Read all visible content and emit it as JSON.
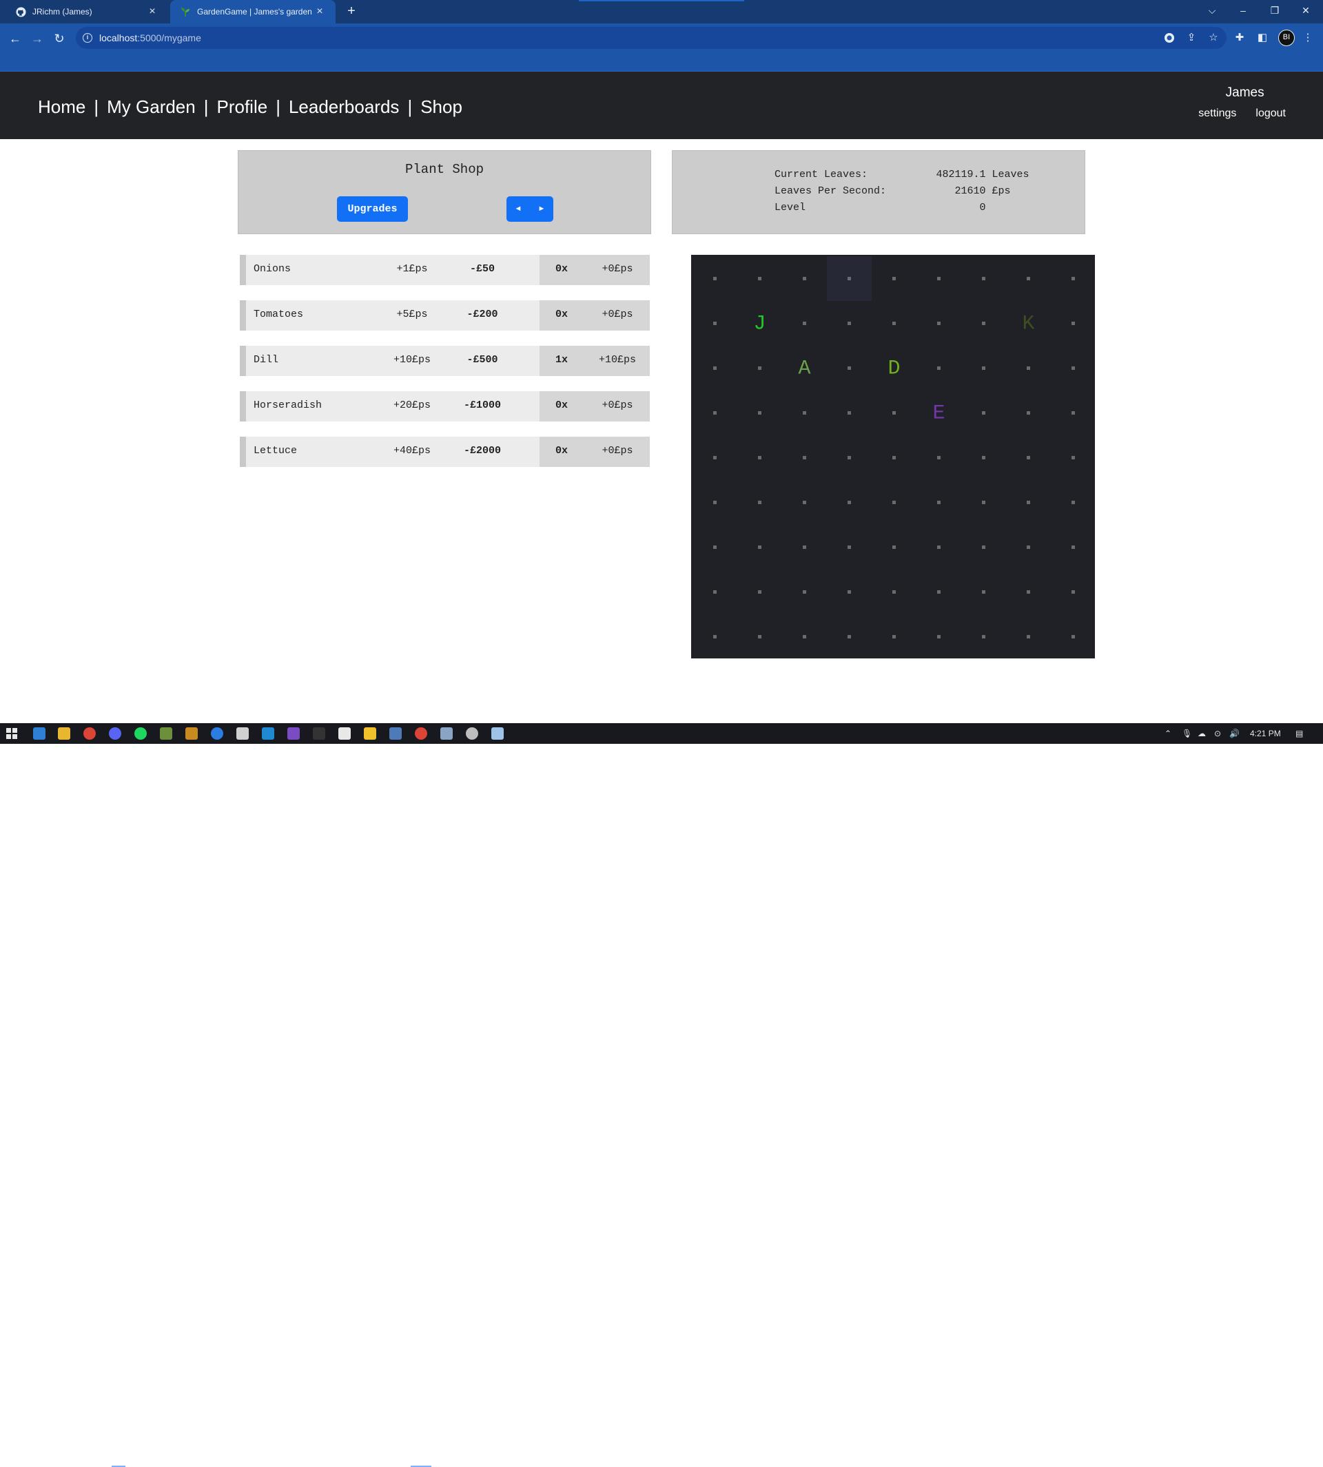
{
  "browser": {
    "tabs": [
      {
        "title": "JRichm (James)",
        "icon": "github-icon",
        "active": false
      },
      {
        "title": "GardenGame | James's garden",
        "icon": "plant-favicon-icon",
        "active": true
      }
    ],
    "address": {
      "host": "localhost",
      "path": ":5000/mygame"
    }
  },
  "site": {
    "nav": [
      {
        "label": "Home"
      },
      {
        "label": "My Garden"
      },
      {
        "label": "Profile"
      },
      {
        "label": "Leaderboards"
      },
      {
        "label": "Shop"
      }
    ],
    "username": "James",
    "user_links": {
      "settings": "settings",
      "logout": "logout"
    }
  },
  "shop": {
    "title": "Plant Shop",
    "upgrades_label": "Upgrades",
    "prev_icon": "◄",
    "next_icon": "►",
    "plants": [
      {
        "name": "Onions",
        "gain": "+1£ps",
        "cost": "-£50",
        "count": "0x",
        "total": "+0£ps"
      },
      {
        "name": "Tomatoes",
        "gain": "+5£ps",
        "cost": "-£200",
        "count": "0x",
        "total": "+0£ps"
      },
      {
        "name": "Dill",
        "gain": "+10£ps",
        "cost": "-£500",
        "count": "1x",
        "total": "+10£ps"
      },
      {
        "name": "Horseradish",
        "gain": "+20£ps",
        "cost": "-£1000",
        "count": "0x",
        "total": "+0£ps"
      },
      {
        "name": "Lettuce",
        "gain": "+40£ps",
        "cost": "-£2000",
        "count": "0x",
        "total": "+0£ps"
      }
    ]
  },
  "stats": {
    "current_leaves_label": "Current Leaves:",
    "current_leaves_value": "482119.1 Leaves",
    "lps_label": "Leaves Per Second:",
    "lps_value": "21610 £ps",
    "level_label": "Level",
    "level_value": "0"
  },
  "garden": {
    "cols": 9,
    "rows": 9,
    "background": "#202027",
    "dot_color": "#6b6b6b",
    "highlight_cell": {
      "col": 3,
      "row": 0,
      "color": "#262836"
    },
    "plants": [
      {
        "letter": "J",
        "col": 1,
        "row": 1,
        "color": "#22c629"
      },
      {
        "letter": "K",
        "col": 7,
        "row": 1,
        "color": "#3e4f1f"
      },
      {
        "letter": "A",
        "col": 2,
        "row": 2,
        "color": "#6ea04a"
      },
      {
        "letter": "D",
        "col": 4,
        "row": 2,
        "color": "#6fb11d"
      },
      {
        "letter": "E",
        "col": 5,
        "row": 3,
        "color": "#7337a8"
      }
    ]
  },
  "taskbar": {
    "time": "4:21 PM"
  }
}
